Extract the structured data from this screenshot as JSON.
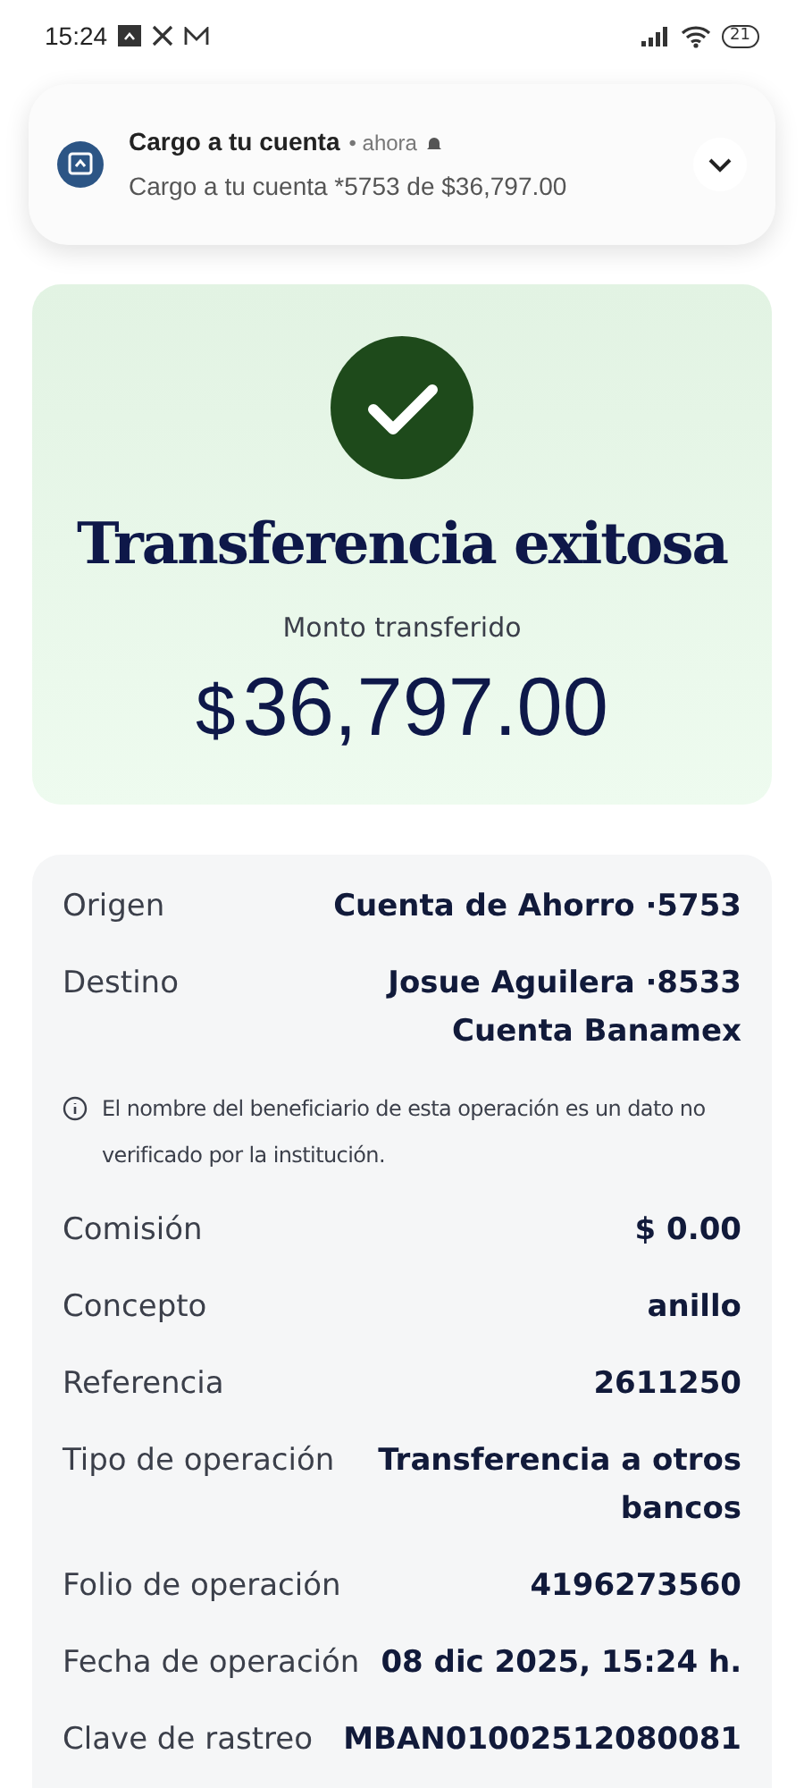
{
  "status_bar": {
    "time": "15:24",
    "battery": "21"
  },
  "notification": {
    "title": "Cargo a tu cuenta",
    "time": "• ahora",
    "message": "Cargo a tu cuenta *5753 de $36,797.00",
    "expanded": false
  },
  "result": {
    "title": "Transferencia exitosa",
    "amount_label": "Monto transferido",
    "currency": "$",
    "amount": "36,797.00"
  },
  "details": [
    {
      "kind": "row",
      "label": "Origen",
      "value": [
        "Cuenta de Ahorro ·5753"
      ]
    },
    {
      "kind": "row",
      "label": "Destino",
      "value": [
        "Josue Aguilera ·8533",
        "Cuenta Banamex"
      ]
    },
    {
      "kind": "note",
      "text": "El nombre del beneficiario de esta operación es un dato no verificado por la institución."
    },
    {
      "kind": "row",
      "label": "Comisión",
      "value": [
        "$ 0.00"
      ]
    },
    {
      "kind": "row",
      "label": "Concepto",
      "value": [
        "anillo"
      ]
    },
    {
      "kind": "row",
      "label": "Referencia",
      "value": [
        "2611250"
      ]
    },
    {
      "kind": "row",
      "label": "Tipo de operación",
      "value": [
        "Transferencia a otros",
        "bancos"
      ]
    },
    {
      "kind": "row",
      "label": "Folio de operación",
      "value": [
        "4196273560"
      ]
    },
    {
      "kind": "row",
      "label": "Fecha de operación",
      "value": [
        "08 dic 2025, 15:24 h."
      ]
    },
    {
      "kind": "row",
      "label": "Clave de rastreo",
      "value": [
        "MBAN01002512080081"
      ]
    }
  ]
}
